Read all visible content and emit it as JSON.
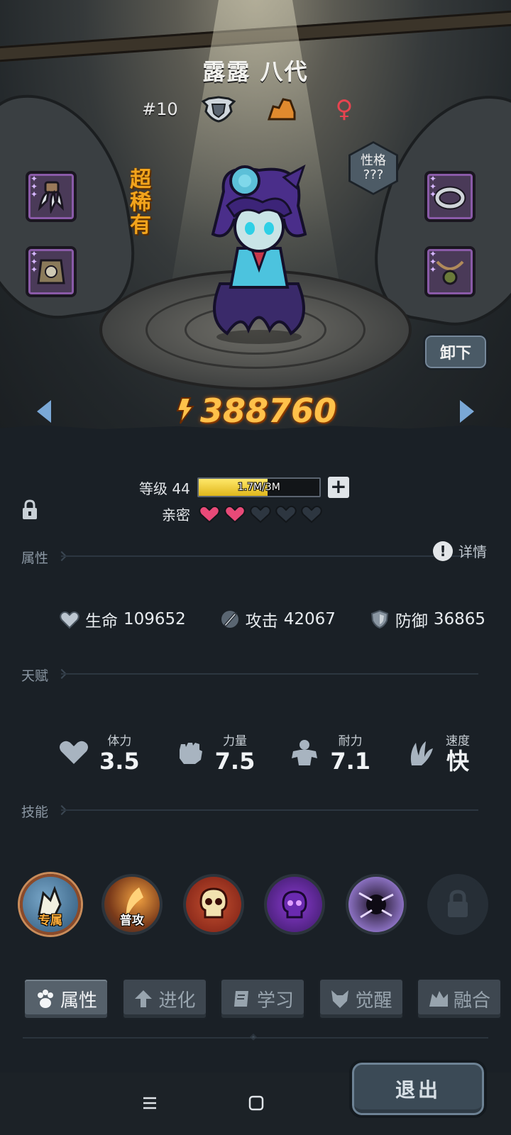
{
  "hero": {
    "name": "露露 八代",
    "rank": "#10",
    "rarity": "超稀有",
    "personality_label": "性格",
    "personality_value": "???",
    "power": "388760"
  },
  "actions": {
    "unequip": "卸下",
    "exit": "退出"
  },
  "progress": {
    "level_label": "等级 44",
    "xp_text": "1.7M/3M",
    "xp_fraction": 0.57,
    "intimacy_label": "亲密",
    "intimacy_filled": 2,
    "intimacy_total": 5
  },
  "sections": {
    "attributes": "属性",
    "talent": "天赋",
    "skills": "技能",
    "details": "详情"
  },
  "attributes": [
    {
      "label": "生命",
      "value": "109652",
      "icon": "heart-shield-icon"
    },
    {
      "label": "攻击",
      "value": "42067",
      "icon": "sword-icon"
    },
    {
      "label": "防御",
      "value": "36865",
      "icon": "shield-icon"
    }
  ],
  "talents": [
    {
      "label": "体力",
      "value": "3.5",
      "icon": "heart-icon"
    },
    {
      "label": "力量",
      "value": "7.5",
      "icon": "fist-icon"
    },
    {
      "label": "耐力",
      "value": "7.1",
      "icon": "muscle-icon"
    },
    {
      "label": "速度",
      "value": "快",
      "icon": "wing-icon"
    }
  ],
  "skills": [
    {
      "tag": "专属",
      "icon": "exclusive-skill-icon"
    },
    {
      "tag": "普攻",
      "icon": "basic-attack-icon"
    },
    {
      "tag": "",
      "icon": "skull-icon"
    },
    {
      "tag": "",
      "icon": "purple-skull-icon"
    },
    {
      "tag": "",
      "icon": "vortex-icon"
    },
    {
      "tag": "",
      "icon": "lock-icon"
    }
  ],
  "tabs": [
    {
      "label": "属性",
      "icon": "paw-icon",
      "active": true
    },
    {
      "label": "进化",
      "icon": "evolve-arrow-icon",
      "active": false
    },
    {
      "label": "学习",
      "icon": "book-icon",
      "active": false
    },
    {
      "label": "觉醒",
      "icon": "wolf-icon",
      "active": false
    },
    {
      "label": "融合",
      "icon": "merge-icon",
      "active": false
    }
  ],
  "colors": {
    "power": "#ffc14a",
    "rarity": "#f2a41c",
    "heart_filled": "#e84a78",
    "heart_empty": "#2d3640",
    "gender": "#e84450"
  }
}
